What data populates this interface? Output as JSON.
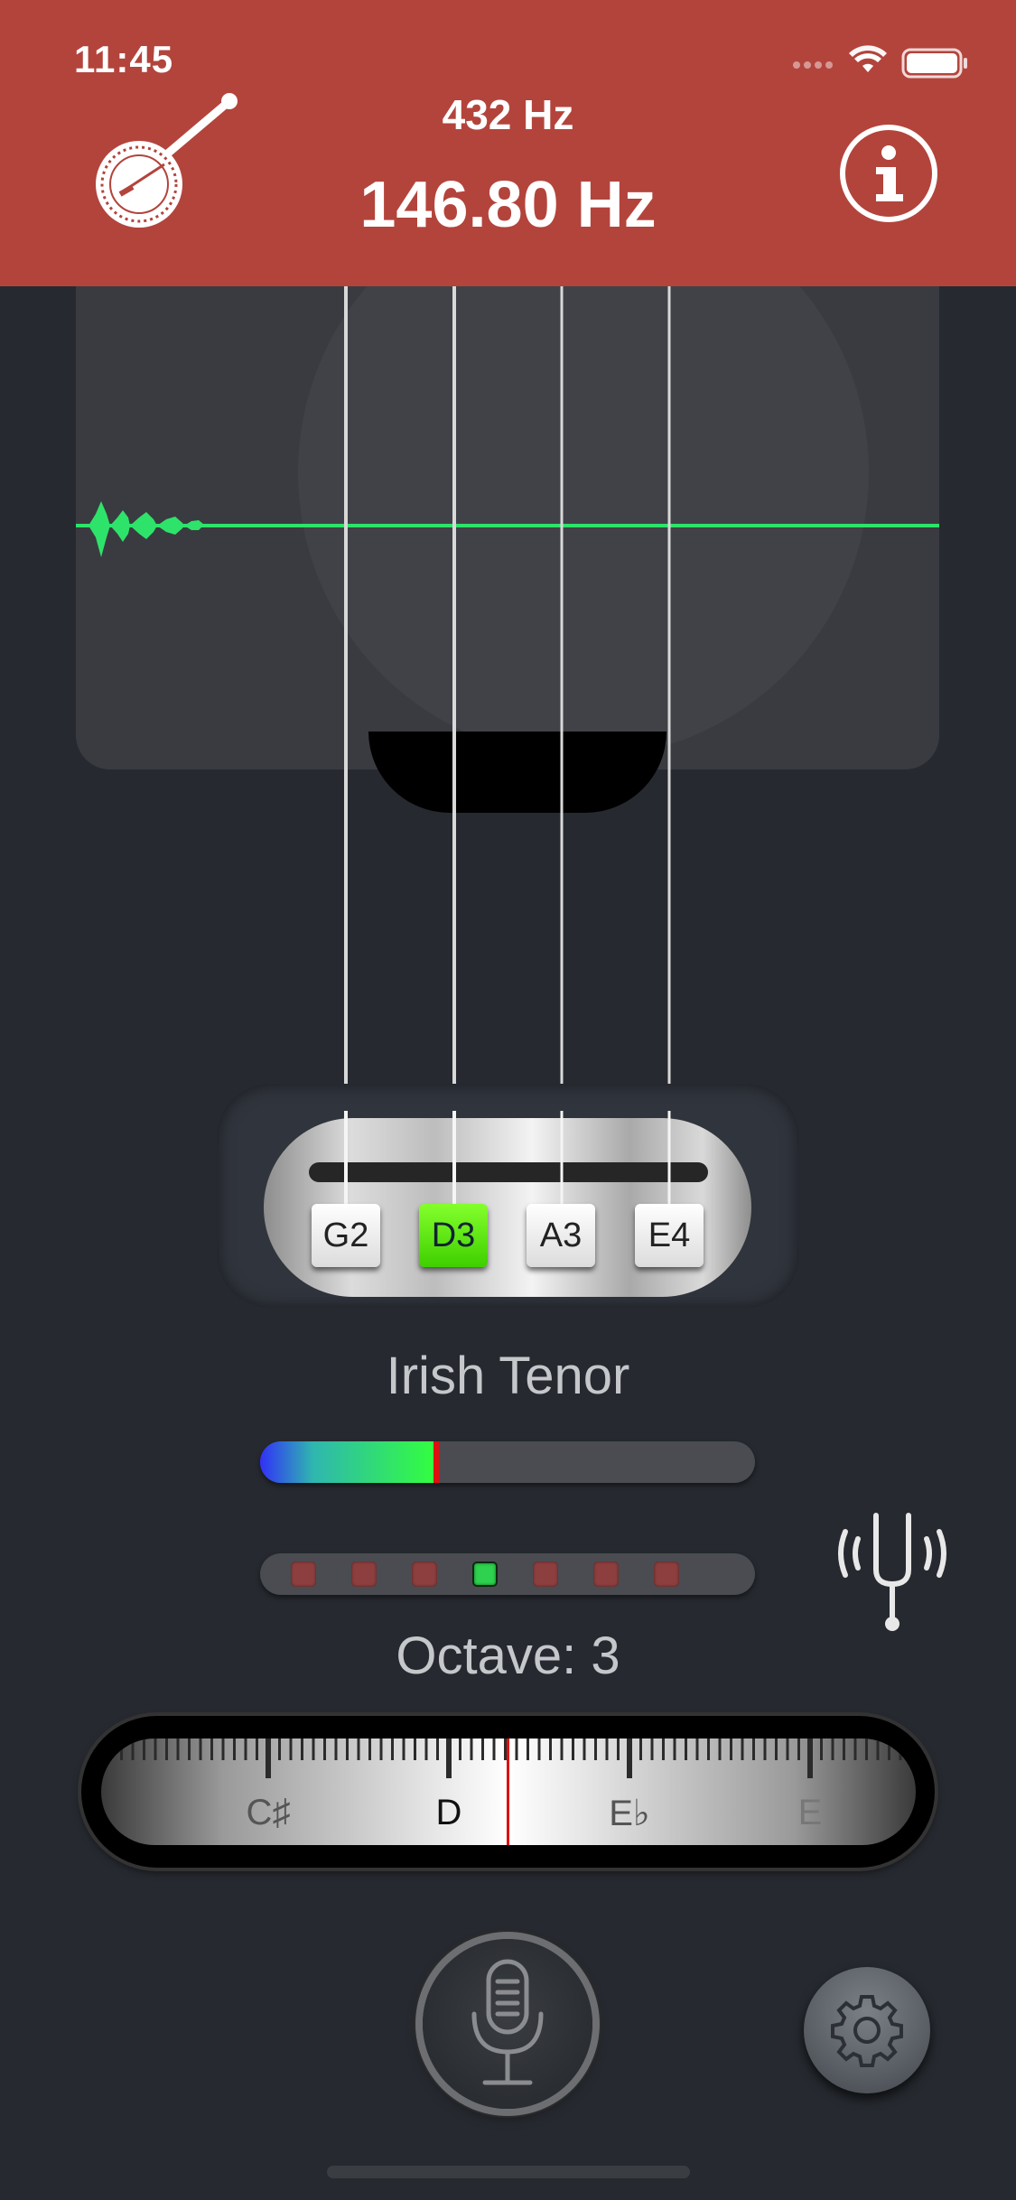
{
  "status_bar": {
    "time": "11:45"
  },
  "header": {
    "reference_frequency": "432 Hz",
    "detected_frequency": "146.80 Hz",
    "instrument_icon": "banjo-icon",
    "info_icon": "info-icon"
  },
  "strings": [
    {
      "label": "G2",
      "active": false
    },
    {
      "label": "D3",
      "active": true
    },
    {
      "label": "A3",
      "active": false
    },
    {
      "label": "E4",
      "active": false
    }
  ],
  "tuning": {
    "name": "Irish Tenor"
  },
  "pitch_meter": {
    "level_fraction": 0.36
  },
  "octave_indicator": {
    "led_count": 7,
    "active_index": 3
  },
  "octave": {
    "label": "Octave: 3"
  },
  "note_ruler": {
    "notes": [
      "C♯",
      "D",
      "E♭",
      "E"
    ],
    "current_note": "D"
  },
  "controls": {
    "mic_icon": "microphone-icon",
    "settings_icon": "gear-icon",
    "tuning_fork_icon": "tuning-fork-icon"
  },
  "colors": {
    "header": "#b3443c",
    "background": "#262a30",
    "waveform": "#2ee36a",
    "active_string": "#6cf016",
    "needle": "#e01010"
  }
}
